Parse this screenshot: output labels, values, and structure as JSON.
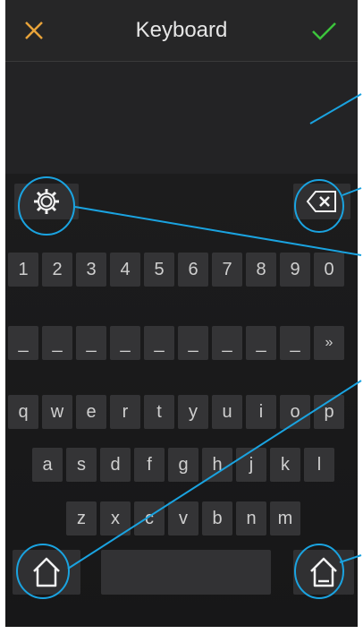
{
  "header": {
    "title": "Keyboard",
    "cancel_icon": "close-icon",
    "confirm_icon": "check-icon"
  },
  "colors": {
    "cancel": "#e8a33a",
    "confirm": "#3cc43c",
    "highlight": "#1aa3e0"
  },
  "keyboard": {
    "settings_icon": "gear-icon",
    "backspace_icon": "backspace-icon",
    "row_numbers": [
      "1",
      "2",
      "3",
      "4",
      "5",
      "6",
      "7",
      "8",
      "9",
      "0"
    ],
    "row_symbols": [
      "_",
      "_",
      "_",
      "_",
      "_",
      "_",
      "_",
      "_",
      "_",
      "»"
    ],
    "row_1": [
      "q",
      "w",
      "e",
      "r",
      "t",
      "y",
      "u",
      "i",
      "o",
      "p"
    ],
    "row_2": [
      "a",
      "s",
      "d",
      "f",
      "g",
      "h",
      "j",
      "k",
      "l"
    ],
    "row_3": [
      "z",
      "x",
      "c",
      "v",
      "b",
      "n",
      "m"
    ],
    "home_left_icon": "home-icon",
    "home_right_icon": "home-underline-icon"
  }
}
